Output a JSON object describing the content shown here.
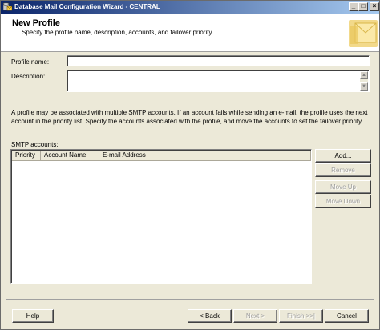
{
  "window": {
    "title": "Database Mail Configuration Wizard - CENTRAL",
    "controls": {
      "minimize": "_",
      "maximize": "□",
      "close": "×"
    }
  },
  "header": {
    "title": "New Profile",
    "subtitle": "Specify the profile name, description, accounts, and failover priority."
  },
  "form": {
    "profile_name_label": "Profile name:",
    "profile_name_value": "",
    "description_label": "Description:",
    "description_value": ""
  },
  "info_text": "A profile may be associated with multiple SMTP accounts. If an account fails while sending an e-mail, the profile uses the next account in the priority list. Specify the accounts associated with the profile, and move the accounts to set the failover priority.",
  "smtp": {
    "label": "SMTP accounts:",
    "columns": [
      "Priority",
      "Account Name",
      "E-mail Address"
    ],
    "rows": []
  },
  "side_buttons": {
    "add": "Add...",
    "remove": "Remove",
    "move_up": "Move Up",
    "move_down": "Move Down"
  },
  "footer": {
    "help": "Help",
    "back": "< Back",
    "next": "Next >",
    "finish": "Finish >>|",
    "cancel": "Cancel"
  },
  "icons": {
    "app": "database-mail-icon",
    "header_art": "envelope-icon",
    "scroll_up": "▲",
    "scroll_down": "▼"
  }
}
